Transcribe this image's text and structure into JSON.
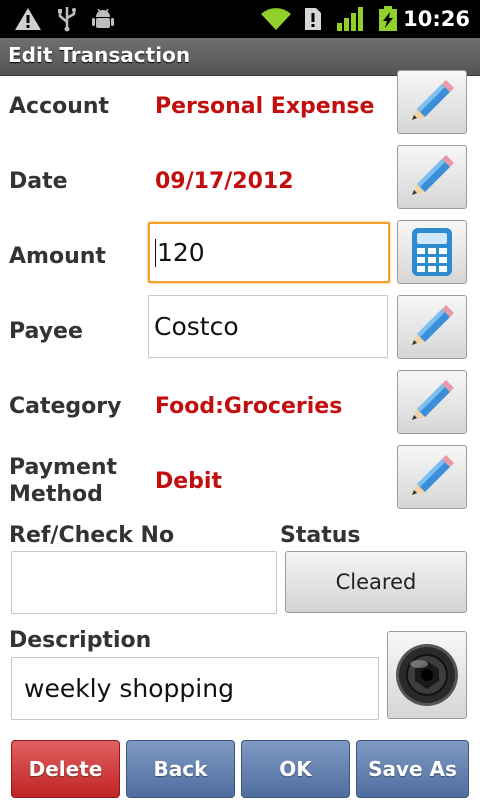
{
  "status_bar": {
    "time": "10:26",
    "icons": [
      "warning-icon",
      "usb-icon",
      "android-debug-icon",
      "wifi-icon",
      "sim-alert-icon",
      "signal-icon",
      "battery-charging-icon"
    ]
  },
  "title": "Edit Transaction",
  "form": {
    "account": {
      "label": "Account",
      "value": "Personal Expense"
    },
    "date": {
      "label": "Date",
      "value": "09/17/2012"
    },
    "amount": {
      "label": "Amount",
      "value": "120"
    },
    "payee": {
      "label": "Payee",
      "value": "Costco"
    },
    "category": {
      "label": "Category",
      "value": "Food:Groceries"
    },
    "payment_method": {
      "label_line1": "Payment",
      "label_line2": "Method",
      "value": "Debit"
    },
    "ref_check": {
      "label": "Ref/Check No",
      "value": ""
    },
    "status": {
      "label": "Status",
      "value": "Cleared"
    },
    "description": {
      "label": "Description",
      "value": "weekly shopping"
    }
  },
  "buttons": {
    "delete": "Delete",
    "back": "Back",
    "ok": "OK",
    "save_as": "Save As"
  },
  "colors": {
    "value_red": "#c20e0e",
    "focus_orange": "#f5a02a",
    "button_blue": "#5f7cad",
    "button_red": "#d03b3b"
  }
}
